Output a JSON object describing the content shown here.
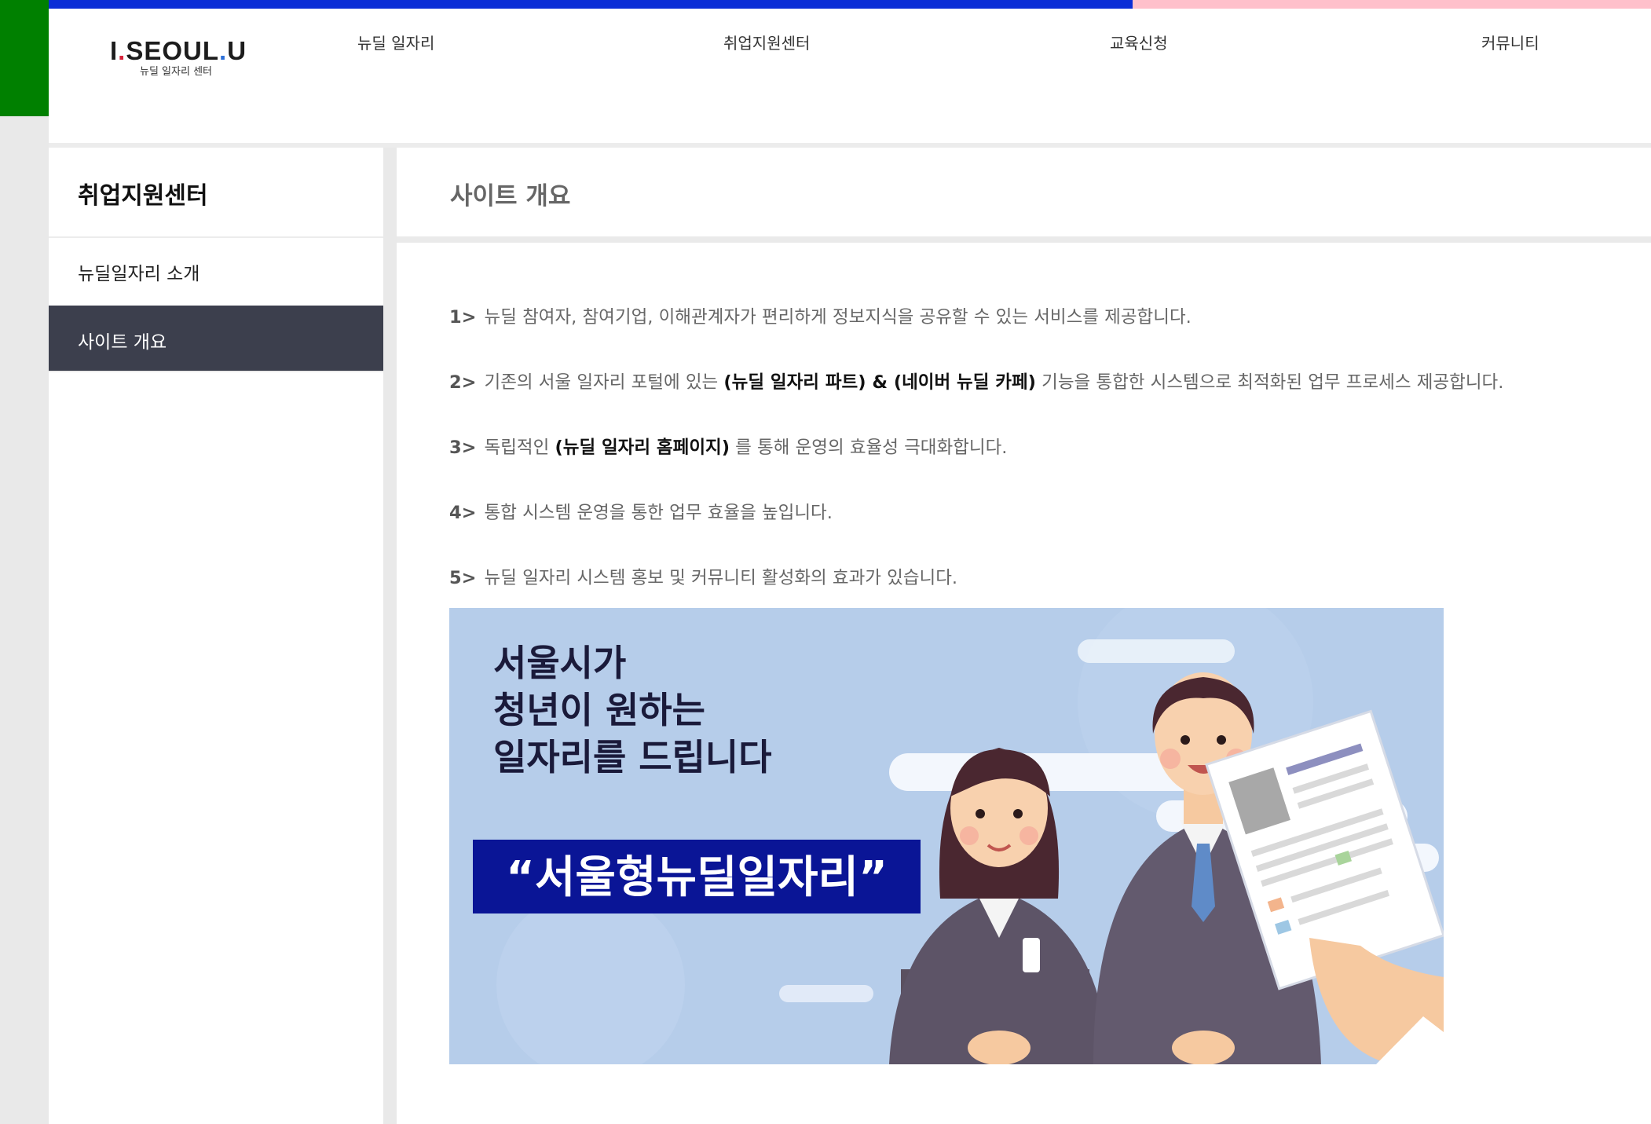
{
  "logo": {
    "main_a": "I",
    "main_dot": ".",
    "main_b": "SEOUL",
    "main_dot2": ".",
    "main_c": "U",
    "sub": "뉴딜 일자리 센터"
  },
  "nav": [
    "뉴딜 일자리",
    "취업지원센터",
    "교육신청",
    "커뮤니티"
  ],
  "sidebar": {
    "title": "취업지원센터",
    "items": [
      {
        "label": "뉴딜일자리 소개",
        "active": false
      },
      {
        "label": "사이트 개요",
        "active": true
      }
    ]
  },
  "main": {
    "title": "사이트 개요",
    "points": [
      {
        "num": "1>",
        "pre": "뉴딜 참여자, 참여기업, 이해관계자가 편리하게 정보지식을 공유할 수 있는 서비스를 제공합니다.",
        "bold1": "",
        "mid": "",
        "bold2": "",
        "post": ""
      },
      {
        "num": "2>",
        "pre": "기존의 서울 일자리 포털에 있는 ",
        "bold1": "(뉴딜 일자리 파트)",
        "mid": " & ",
        "bold2": "(네이버 뉴딜 카페)",
        "post": " 기능을 통합한 시스템으로 최적화된 업무 프로세스 제공합니다."
      },
      {
        "num": "3>",
        "pre": "독립적인 ",
        "bold1": "(뉴딜 일자리 홈페이지)",
        "mid": "",
        "bold2": "",
        "post": " 를 통해 운영의 효율성 극대화합니다."
      },
      {
        "num": "4>",
        "pre": "통합 시스템 운영을 통한 업무 효율을 높입니다.",
        "bold1": "",
        "mid": "",
        "bold2": "",
        "post": ""
      },
      {
        "num": "5>",
        "pre": "뉴딜 일자리 시스템 홍보 및 커뮤니티 활성화의 효과가 있습니다.",
        "bold1": "",
        "mid": "",
        "bold2": "",
        "post": ""
      }
    ],
    "banner": {
      "line1": "서울시가",
      "line2": "청년이 원하는",
      "line3": "일자리를 드립니다",
      "badge": "“서울형뉴딜일자리”"
    }
  },
  "colors": {
    "green_strip": "#008000",
    "top_blue": "#0b2ed6",
    "top_pink": "#ffc0cb",
    "sidebar_active": "#3c3f4d",
    "banner_bg": "#b6cdea",
    "badge_bg": "#0a1596"
  }
}
